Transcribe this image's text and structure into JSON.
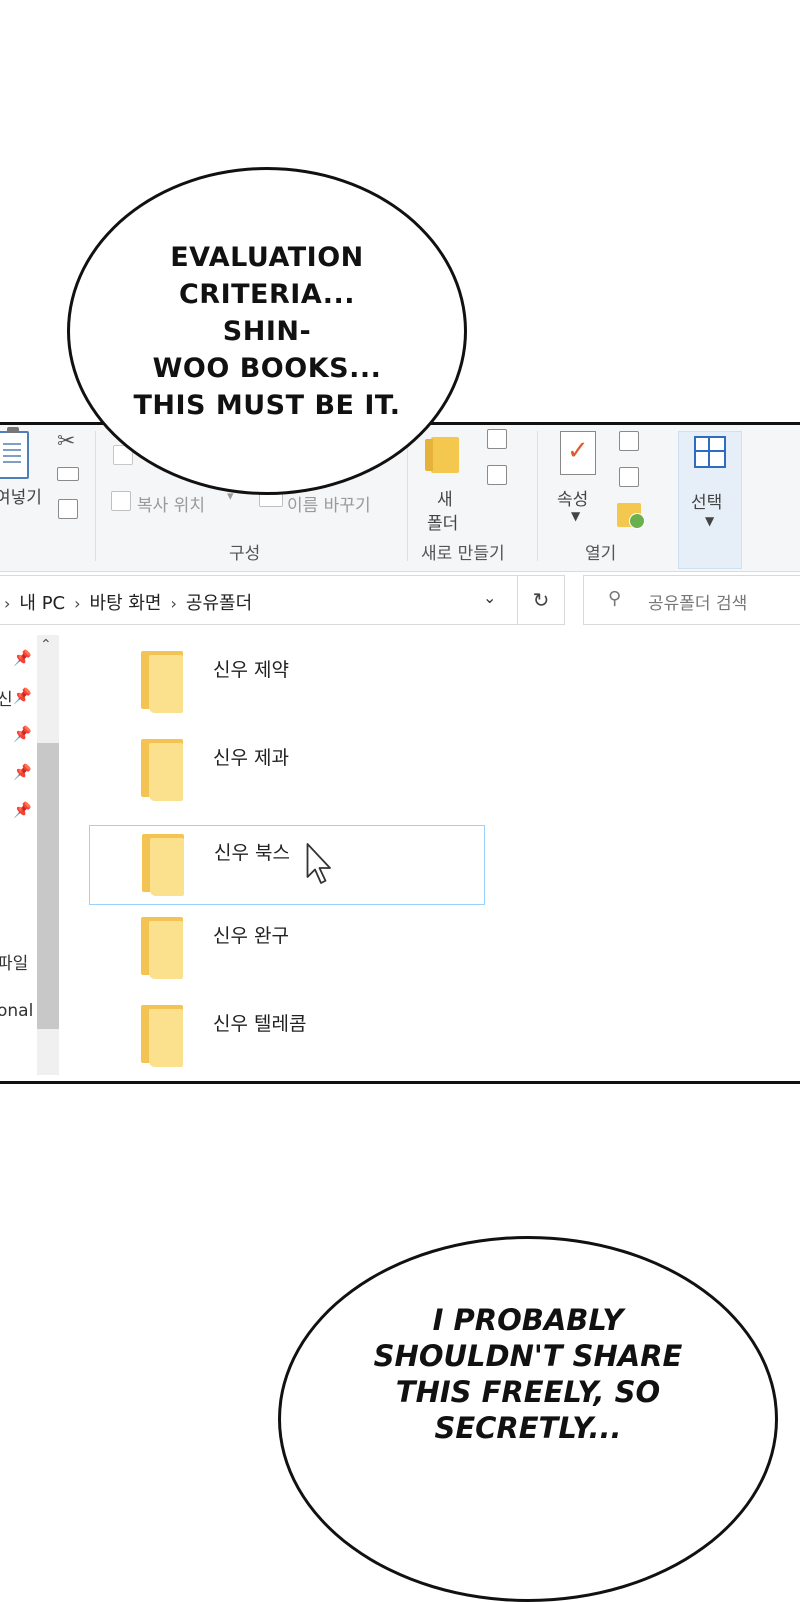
{
  "bubbles": {
    "top": [
      "EVALUATION",
      "CRITERIA... SHIN-",
      "WOO BOOKS...",
      "THIS MUST BE IT."
    ],
    "bottom": [
      "I PROBABLY",
      "SHOULDN'T SHARE",
      "THIS FREELY, SO",
      "SECRETLY..."
    ]
  },
  "ribbon": {
    "paste_partial": "여넣기",
    "copy_path": "복사 위치",
    "rename": "이름 바꾸기",
    "new_folder_1": "새",
    "new_folder_2": "폴더",
    "properties": "속성",
    "select": "선택",
    "groups": {
      "organize": "구성",
      "new": "새로 만들기",
      "open": "열기"
    }
  },
  "address": {
    "crumbs": [
      "내 PC",
      "바탕 화면",
      "공유폴더"
    ],
    "search_placeholder": "공유폴더 검색"
  },
  "nav": {
    "label_partial_1": "신",
    "label_partial_2": "파일",
    "label_partial_3": "onal"
  },
  "folders": [
    {
      "name": "신우 제약",
      "selected": false
    },
    {
      "name": "신우 제과",
      "selected": false
    },
    {
      "name": "신우 북스",
      "selected": true
    },
    {
      "name": "신우 완구",
      "selected": false
    },
    {
      "name": "신우 텔레콤",
      "selected": false
    }
  ]
}
